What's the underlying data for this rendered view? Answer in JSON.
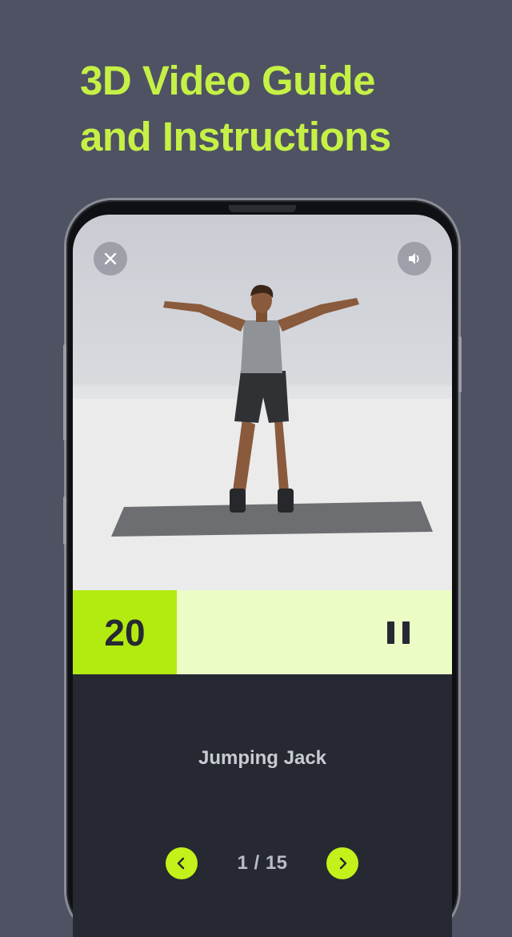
{
  "headline": {
    "line1": "3D Video Guide",
    "line2": "and Instructions"
  },
  "video": {
    "close_icon": "close-icon",
    "sound_icon": "volume-icon"
  },
  "timer": {
    "count": "20",
    "pause_icon": "pause-icon"
  },
  "exercise": {
    "name": "Jumping Jack"
  },
  "pager": {
    "current": "1 / 15",
    "prev_icon": "chevron-left-icon",
    "next_icon": "chevron-right-icon"
  },
  "colors": {
    "background": "#4f5262",
    "accent": "#c5f146",
    "counter": "#b3ea10",
    "timer_bar": "#ecfcc5",
    "panel": "#262931"
  }
}
